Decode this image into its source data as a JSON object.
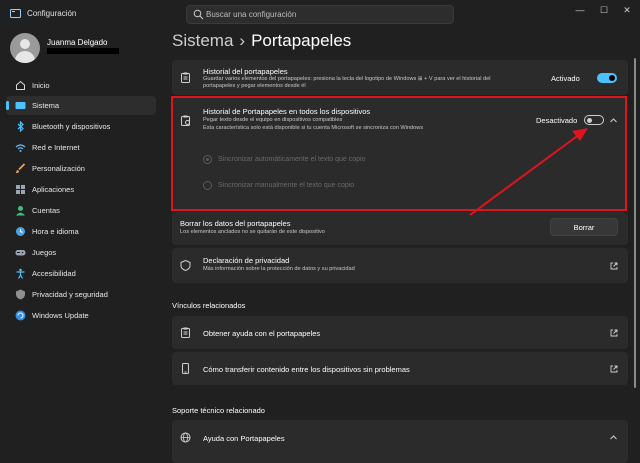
{
  "window": {
    "app_title": "Configuración",
    "controls": [
      "—",
      "☐",
      "✕"
    ]
  },
  "search": {
    "placeholder": "Buscar una configuración"
  },
  "user": {
    "name": "Juanma Delgado"
  },
  "sidebar": {
    "items": [
      {
        "label": "Inicio",
        "icon": "home-icon",
        "color": "#d8d8d8"
      },
      {
        "label": "Sistema",
        "icon": "system-icon",
        "color": "#4cc2ff",
        "active": true
      },
      {
        "label": "Bluetooth y dispositivos",
        "icon": "bluetooth-icon",
        "color": "#4cc2ff"
      },
      {
        "label": "Red e Internet",
        "icon": "network-icon",
        "color": "#6ab7f5"
      },
      {
        "label": "Personalización",
        "icon": "brush-icon",
        "color": "#e8a060"
      },
      {
        "label": "Aplicaciones",
        "icon": "apps-icon",
        "color": "#9aa5b4"
      },
      {
        "label": "Cuentas",
        "icon": "accounts-icon",
        "color": "#3fbf7f"
      },
      {
        "label": "Hora e idioma",
        "icon": "time-language-icon",
        "color": "#4aa3e8"
      },
      {
        "label": "Juegos",
        "icon": "gamepad-icon",
        "color": "#9aa5b4"
      },
      {
        "label": "Accesibilidad",
        "icon": "accessibility-icon",
        "color": "#4cc2ff"
      },
      {
        "label": "Privacidad y seguridad",
        "icon": "shield-icon",
        "color": "#8f8f8f"
      },
      {
        "label": "Windows Update",
        "icon": "windows-update-icon",
        "color": "#2f8ee8"
      }
    ]
  },
  "header": {
    "crumb": "Sistema",
    "separator": "›",
    "title": "Portapapeles"
  },
  "history": {
    "title": "Historial del portapapeles",
    "desc_line1": "Guardar varios elementos del portapapeles: presiona la tecla del logotipo de Windows ⊞ + V para ver el historial del",
    "desc_line2": "portapapeles y pegar elementos desde él",
    "state": "Activado"
  },
  "sync": {
    "title": "Historial de Portapapeles en todos los dispositivos",
    "desc_line1": "Pegar texto desde el equipo en dispositivos compatibles",
    "desc_line2": "Esta característica solo está disponible si tu cuenta Microsoft se sincroniza con Windows",
    "state": "Desactivado",
    "options": [
      "Sincronizar automáticamente el texto que copio",
      "Sincronizar manualmente el texto que copio"
    ]
  },
  "clear": {
    "title": "Borrar los datos del portapapeles",
    "desc": "Los elementos anclados no se quitarán de este dispositivo",
    "button": "Borrar"
  },
  "privacy": {
    "title": "Declaración de privacidad",
    "desc": "Más información sobre la protección de datos y su privacidad"
  },
  "related": {
    "heading": "Vínculos relacionados",
    "links": [
      "Obtener ayuda con el portapapeles",
      "Cómo transferir contenido entre los dispositivos sin problemas"
    ]
  },
  "support": {
    "heading": "Soporte técnico relacionado",
    "item": "Ayuda con Portapapeles"
  },
  "colors": {
    "accent": "#4cc2ff",
    "highlight": "#e0141e",
    "background": "#202020",
    "card": "#2b2b2b"
  }
}
